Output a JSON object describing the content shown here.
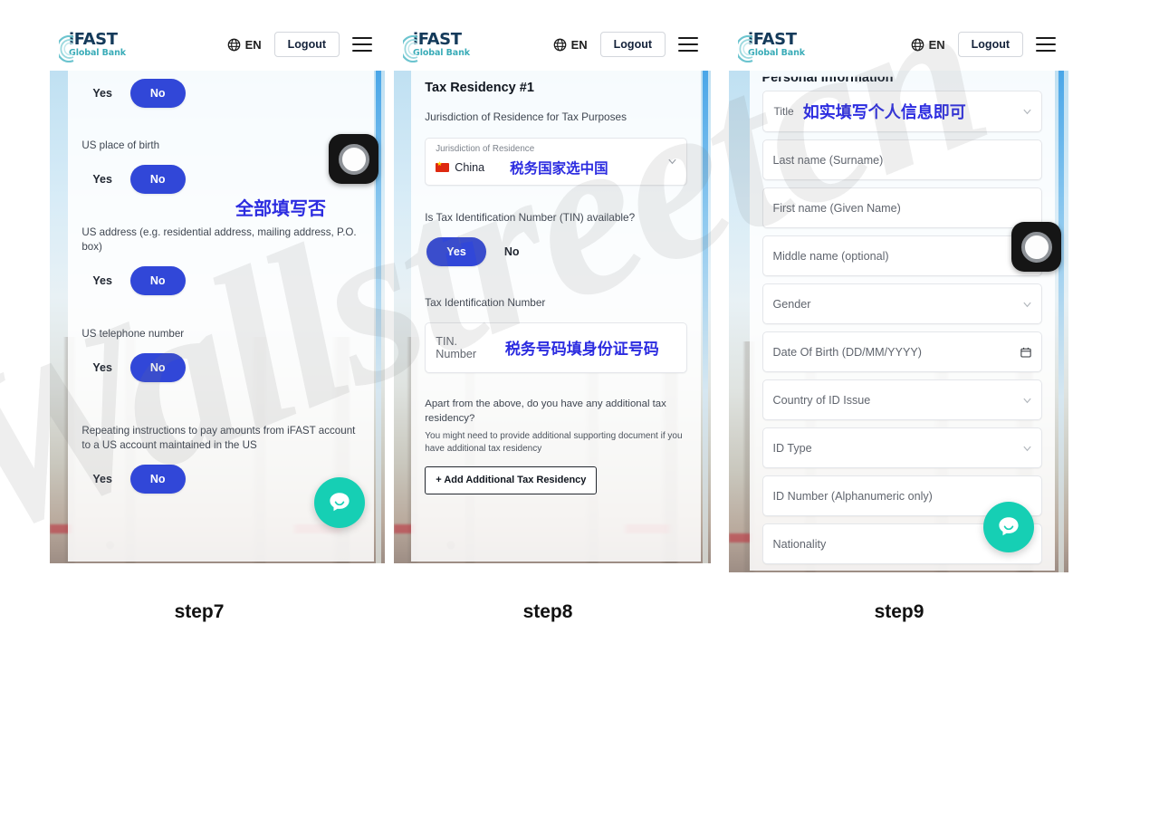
{
  "watermark_text": "Wallstreetcn",
  "header": {
    "logo_main": "iFAST",
    "logo_sub": "Global Bank",
    "lang_label": "EN",
    "logout_label": "Logout",
    "globe_icon": "globe-icon",
    "menu_icon": "hamburger-menu-icon"
  },
  "colors": {
    "primary_blue": "#3147d8",
    "chat_teal": "#16cfb4",
    "annotation_blue": "#2c2ce0",
    "logo_navy": "#143a5a",
    "logo_teal": "#3aacb8"
  },
  "panels": [
    {
      "caption": "step7",
      "annotation": "全部填写否",
      "questions": [
        {
          "label": "",
          "yes": "Yes",
          "no": "No",
          "selected": "No"
        },
        {
          "label": "US place of birth",
          "yes": "Yes",
          "no": "No",
          "selected": "No"
        },
        {
          "label": "US address (e.g. residential address, mailing address, P.O. box)",
          "yes": "Yes",
          "no": "No",
          "selected": "No"
        },
        {
          "label": "US telephone number",
          "yes": "Yes",
          "no": "No",
          "selected": "No"
        },
        {
          "label": "Repeating instructions to pay amounts from iFAST account to a US account maintained in the US",
          "yes": "Yes",
          "no": "No",
          "selected": "No"
        }
      ]
    },
    {
      "caption": "step8",
      "title": "Tax Residency #1",
      "jurisdiction_question": "Jurisdiction of Residence for Tax Purposes",
      "jurisdiction_field_label": "Jurisdiction of Residence",
      "jurisdiction_value": "China",
      "jurisdiction_flag": "china-flag-icon",
      "jurisdiction_annotation": "税务国家选中国",
      "tin_question": "Is Tax Identification Number (TIN) available?",
      "tin_yes": "Yes",
      "tin_no": "No",
      "tin_selected": "Yes",
      "tin_label": "Tax Identification Number",
      "tin_placeholder": "TIN. Number",
      "tin_annotation": "税务号码填身份证号码",
      "additional_question": "Apart from the above, do you have any additional tax residency?",
      "additional_note": "You might need to provide additional supporting document if you have additional tax residency",
      "add_button": "+ Add Additional Tax Residency"
    },
    {
      "caption": "step9",
      "title": "Personal Information",
      "title_annotation": "如实填写个人信息即可",
      "fields": [
        {
          "label": "Title",
          "type": "select",
          "annotation": "如实填写个人信息即可"
        },
        {
          "label": "Last name (Surname)",
          "type": "text"
        },
        {
          "label": "First name (Given Name)",
          "type": "text"
        },
        {
          "label": "Middle name (optional)",
          "type": "text"
        },
        {
          "label": "Gender",
          "type": "select"
        },
        {
          "label": "Date Of Birth (DD/MM/YYYY)",
          "type": "date"
        },
        {
          "label": "Country of ID Issue",
          "type": "select"
        },
        {
          "label": "ID Type",
          "type": "select"
        },
        {
          "label": "ID Number (Alphanumeric only)",
          "type": "text"
        },
        {
          "label": "Nationality",
          "type": "text"
        }
      ]
    }
  ]
}
